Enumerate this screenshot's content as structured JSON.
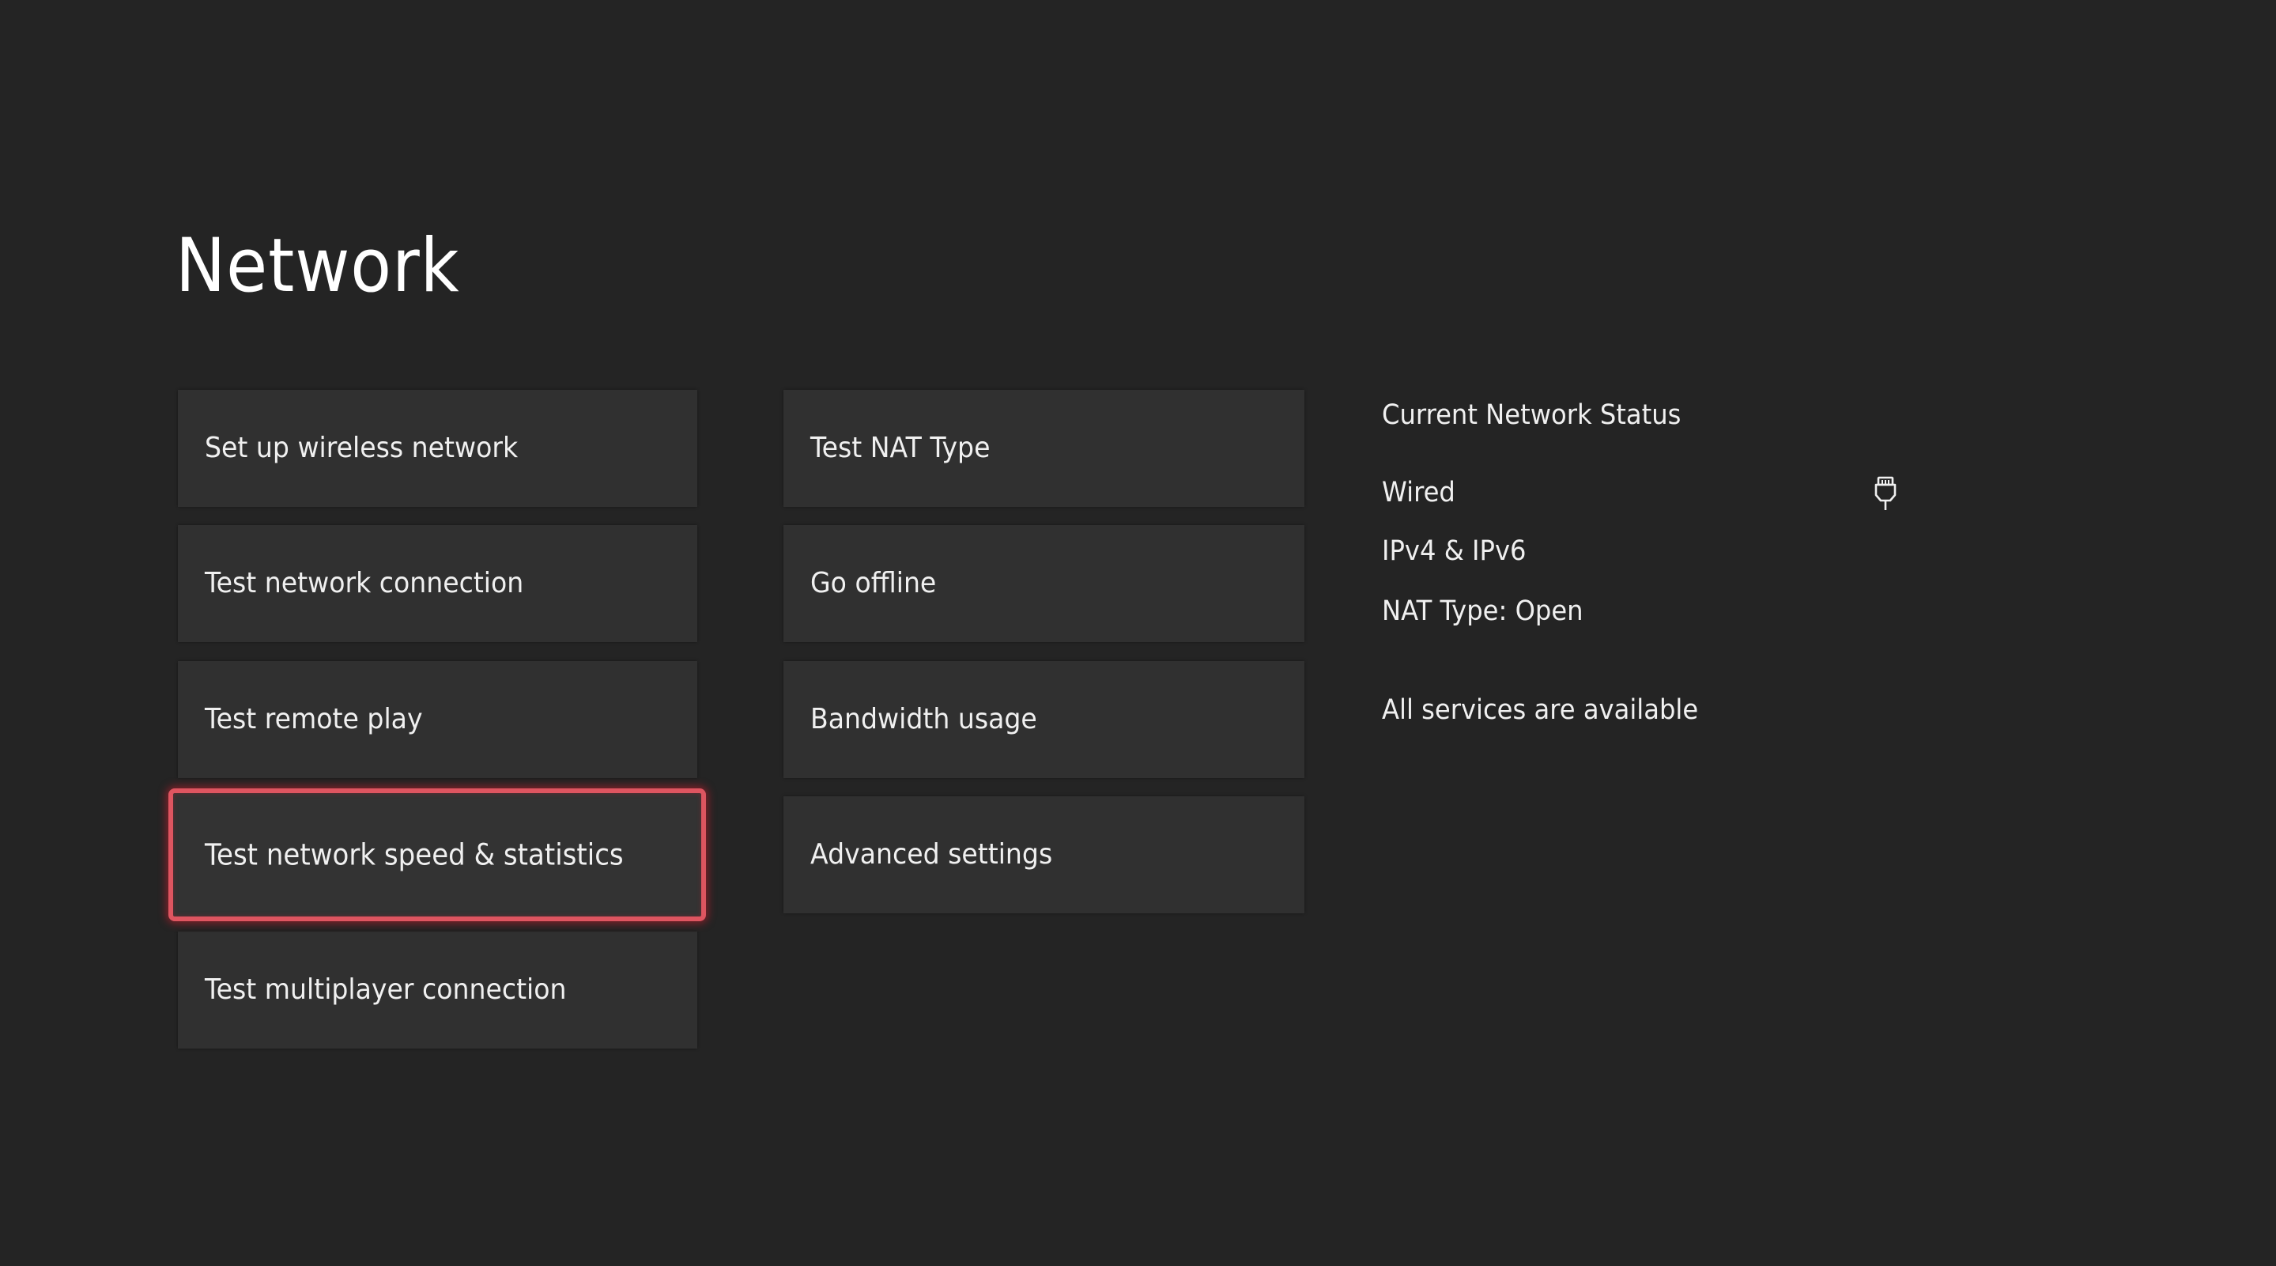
{
  "page": {
    "title": "Network"
  },
  "menu": {
    "column1": [
      {
        "label": "Set up wireless network"
      },
      {
        "label": "Test network connection"
      },
      {
        "label": "Test remote play"
      },
      {
        "label": "Test network speed & statistics",
        "focused": true
      },
      {
        "label": "Test multiplayer connection"
      }
    ],
    "column2": [
      {
        "label": "Test NAT Type"
      },
      {
        "label": "Go offline"
      },
      {
        "label": "Bandwidth usage"
      },
      {
        "label": "Advanced settings"
      }
    ]
  },
  "status": {
    "heading": "Current Network Status",
    "connection_type": "Wired",
    "connection_icon": "ethernet-icon",
    "ip_versions": "IPv4 & IPv6",
    "nat_type": "NAT Type: Open",
    "services": "All services are available"
  },
  "colors": {
    "background": "#242424",
    "tile": "#303030",
    "focus_border": "#de5560",
    "text": "#f0f0f0"
  }
}
